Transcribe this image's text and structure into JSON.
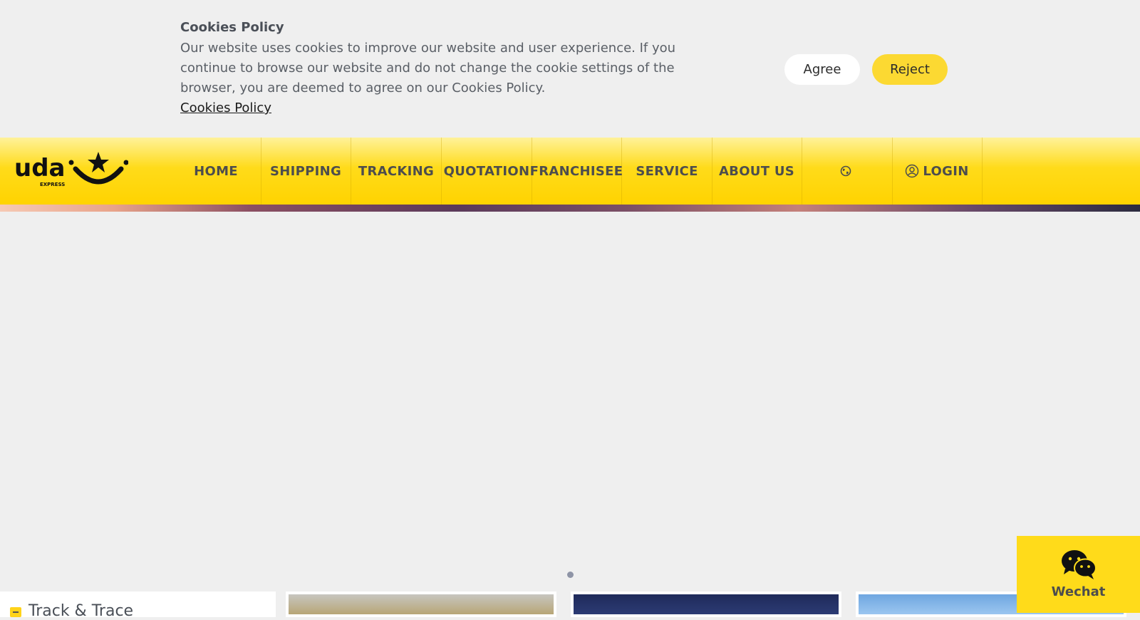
{
  "cookie_banner": {
    "title": "Cookies Policy",
    "message": "Our website uses cookies to improve our website and user experience. If you continue to browse our website and do not change the cookie settings of the browser, you are deemed to agree on our Cookies Policy.",
    "link_label": "Cookies Policy",
    "agree_label": "Agree",
    "reject_label": "Reject"
  },
  "nav": {
    "items": [
      {
        "label": "HOME"
      },
      {
        "label": "SHIPPING"
      },
      {
        "label": "TRACKING"
      },
      {
        "label": "QUOTATION"
      },
      {
        "label": "FRANCHISEE"
      },
      {
        "label": "SERVICE"
      },
      {
        "label": "ABOUT US"
      },
      {
        "label": ""
      },
      {
        "label": "LOGIN"
      }
    ]
  },
  "track_panel": {
    "title": "Track & Trace"
  },
  "wechat": {
    "label": "Wechat"
  },
  "colors": {
    "brand_yellow": "#ffd300",
    "background": "#efefef"
  }
}
